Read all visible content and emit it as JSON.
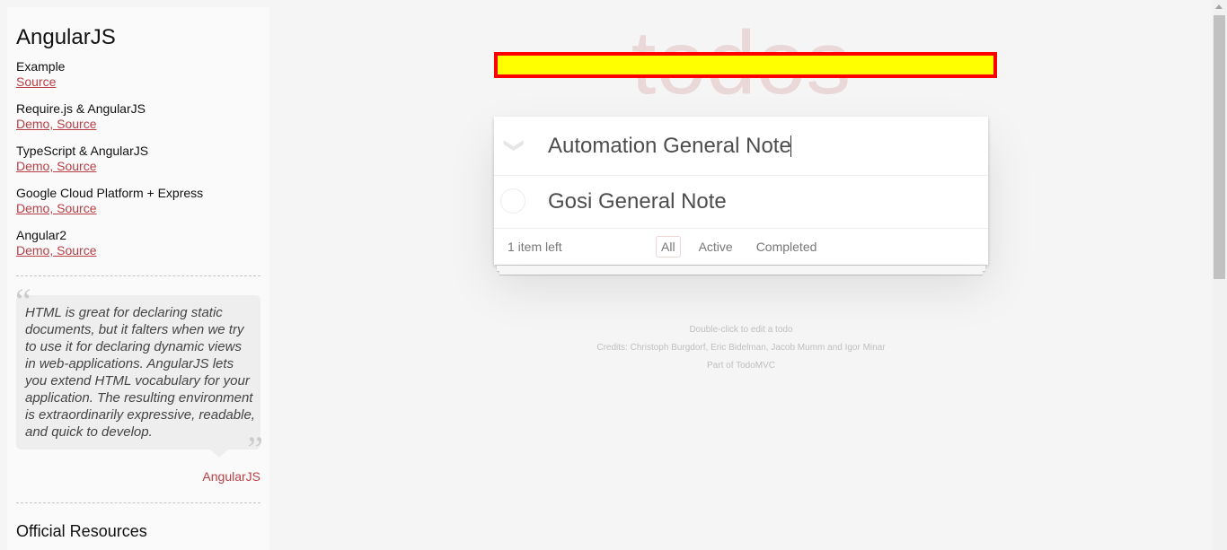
{
  "sidebar": {
    "title": "AngularJS",
    "items": [
      {
        "name": "Example",
        "links": "Source"
      },
      {
        "name": "Require.js & AngularJS",
        "links": "Demo, Source"
      },
      {
        "name": "TypeScript & AngularJS",
        "links": "Demo, Source"
      },
      {
        "name": "Google Cloud Platform + Express",
        "links": "Demo, Source"
      },
      {
        "name": "Angular2",
        "links": "Demo, Source"
      }
    ],
    "quote": "HTML is great for declaring static documents, but it falters when we try to use it for declaring dynamic views in web-applications. AngularJS lets you extend HTML vocabulary for your application. The resulting environment is extraordinarily expressive, readable, and quick to develop.",
    "quote_author": "AngularJS",
    "resources_heading": "Official Resources"
  },
  "app": {
    "title": "todos",
    "new_todo_value": "Automation General Note",
    "toggle_all_glyph": "❯",
    "todos": [
      {
        "title": "Gosi General Note",
        "completed": false
      }
    ],
    "footer": {
      "count": "1 item left",
      "filters": [
        "All",
        "Active",
        "Completed"
      ],
      "selected": "All"
    },
    "info": [
      "Double-click to edit a todo",
      "Credits: Christoph Burgdorf, Eric Bidelman, Jacob Mumm and Igor Minar",
      "Part of TodoMVC"
    ]
  },
  "colors": {
    "accent": "#b83f45",
    "highlight_border": "#ff0000",
    "highlight_fill": "#ffff00"
  }
}
